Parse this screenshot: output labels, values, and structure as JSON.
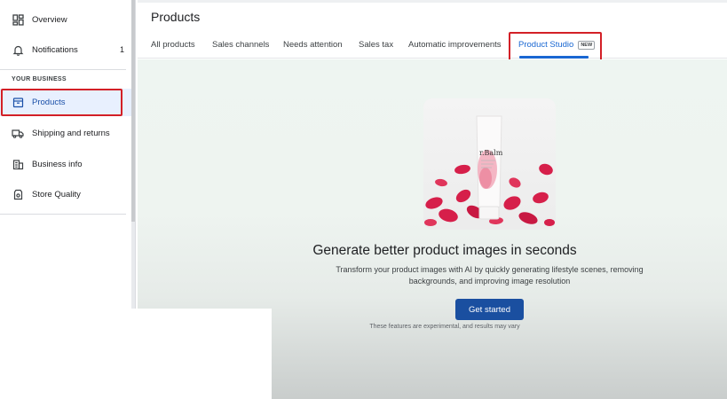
{
  "sidebar": {
    "items": [
      {
        "label": "Overview",
        "icon": "dashboard-icon"
      },
      {
        "label": "Notifications",
        "icon": "bell-icon",
        "count": "1"
      },
      {
        "label": "Products",
        "icon": "product-box-icon"
      },
      {
        "label": "Shipping and returns",
        "icon": "truck-icon"
      },
      {
        "label": "Business info",
        "icon": "building-icon"
      },
      {
        "label": "Store Quality",
        "icon": "store-quality-icon"
      }
    ],
    "section_label": "YOUR BUSINESS",
    "active_item": "Products"
  },
  "main": {
    "title": "Products",
    "tabs": [
      {
        "label": "All products"
      },
      {
        "label": "Sales channels"
      },
      {
        "label": "Needs attention"
      },
      {
        "label": "Sales tax"
      },
      {
        "label": "Automatic improvements"
      },
      {
        "label": "Product Studio",
        "badge": "NEW"
      }
    ],
    "active_tab": "Product Studio"
  },
  "studio": {
    "headline": "Generate better product images in seconds",
    "subtext": "Transform your product images with AI by quickly generating lifestyle scenes, removing backgrounds, and improving image resolution",
    "cta_label": "Get started",
    "disclaimer": "These features are experimental, and results may vary",
    "product_image": {
      "brand_text": "r.Balm"
    }
  },
  "colors": {
    "accent": "#1967d2",
    "button": "#1a4fa0",
    "highlight_box": "#d32027",
    "active_nav_bg": "#e8f0fe"
  }
}
